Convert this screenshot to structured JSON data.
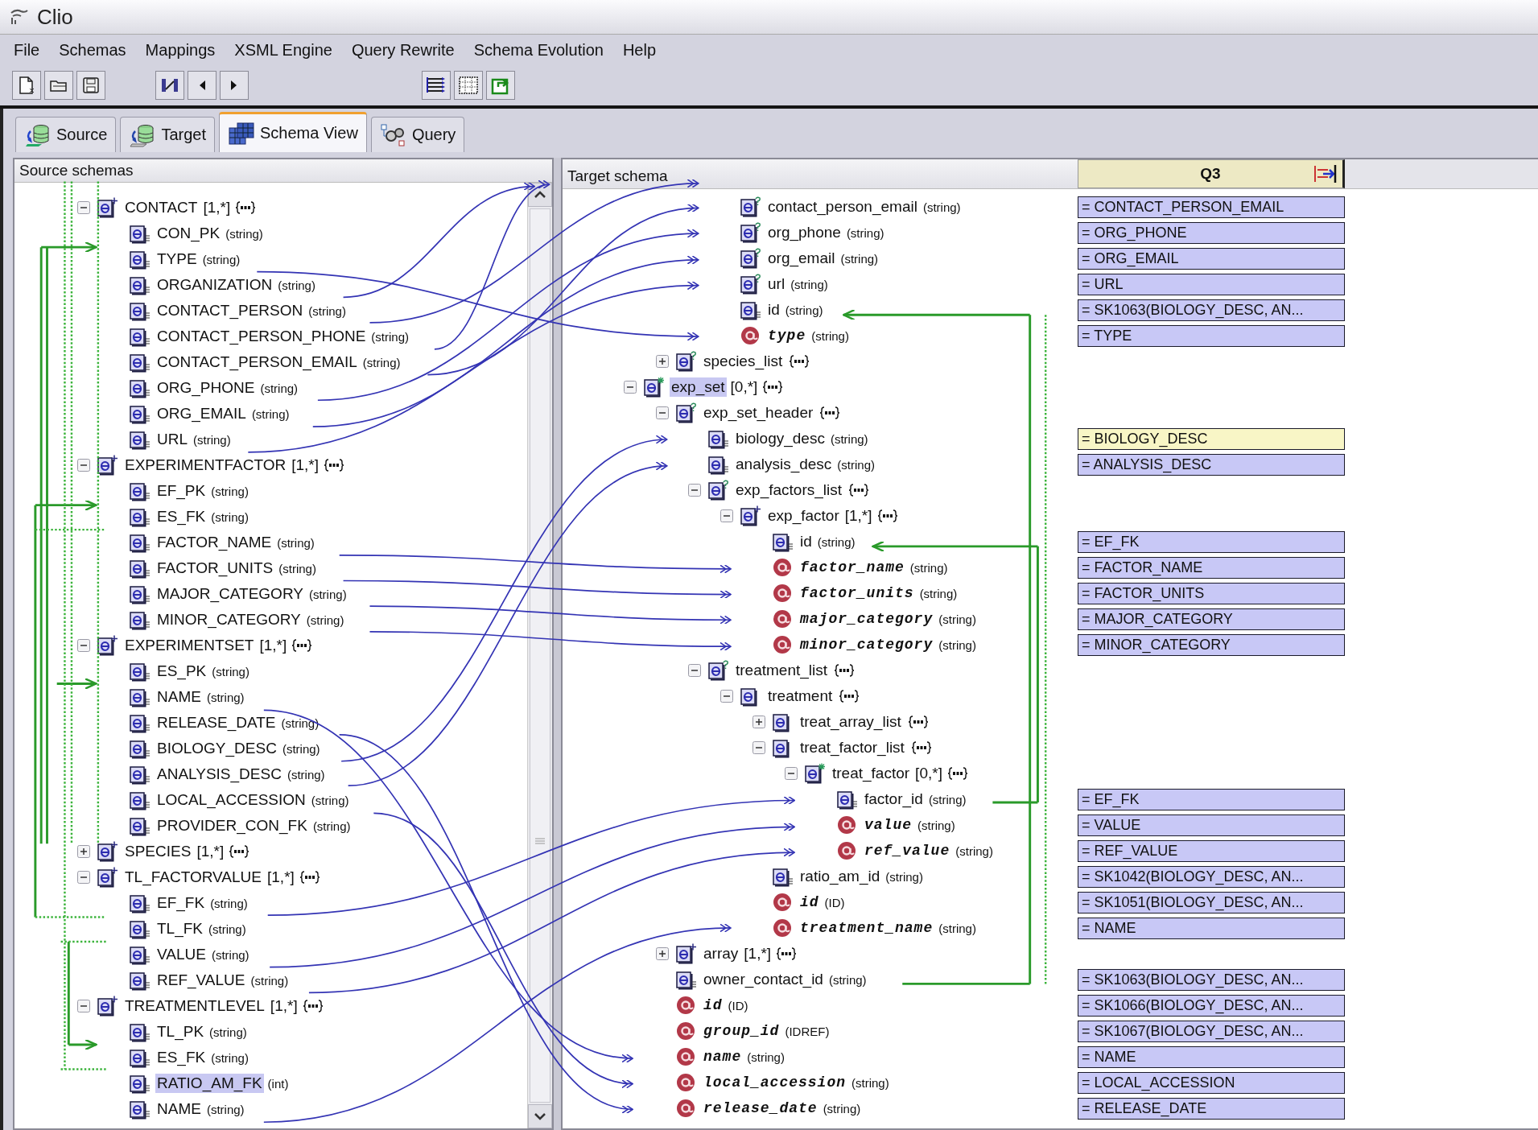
{
  "window": {
    "title": "Clio"
  },
  "menu": [
    "File",
    "Schemas",
    "Mappings",
    "XSML Engine",
    "Query Rewrite",
    "Schema Evolution",
    "Help"
  ],
  "tabs": [
    {
      "label": "Source",
      "kind": "source",
      "selected": false
    },
    {
      "label": "Target",
      "kind": "target",
      "selected": false
    },
    {
      "label": "Schema View",
      "kind": "view",
      "selected": true
    },
    {
      "label": "Query",
      "kind": "query",
      "selected": false
    }
  ],
  "source_panel": {
    "title": "Source schemas",
    "tree": [
      {
        "name": "CONTACT",
        "card": "[1,*]",
        "kind": "repeat",
        "expanded": true,
        "selected": false,
        "children": [
          {
            "name": "CON_PK",
            "type": "(string)",
            "kind": "leaf",
            "selected": false
          },
          {
            "name": "TYPE",
            "type": "(string)",
            "kind": "leaf",
            "selected": false
          },
          {
            "name": "ORGANIZATION",
            "type": "(string)",
            "kind": "leaf",
            "selected": false
          },
          {
            "name": "CONTACT_PERSON",
            "type": "(string)",
            "kind": "leaf",
            "selected": false
          },
          {
            "name": "CONTACT_PERSON_PHONE",
            "type": "(string)",
            "kind": "leaf",
            "selected": false
          },
          {
            "name": "CONTACT_PERSON_EMAIL",
            "type": "(string)",
            "kind": "leaf",
            "selected": false
          },
          {
            "name": "ORG_PHONE",
            "type": "(string)",
            "kind": "leaf",
            "selected": false
          },
          {
            "name": "ORG_EMAIL",
            "type": "(string)",
            "kind": "leaf",
            "selected": false
          },
          {
            "name": "URL",
            "type": "(string)",
            "kind": "leaf",
            "selected": false
          }
        ]
      },
      {
        "name": "EXPERIMENTFACTOR",
        "card": "[1,*]",
        "kind": "repeat",
        "expanded": true,
        "selected": false,
        "children": [
          {
            "name": "EF_PK",
            "type": "(string)",
            "kind": "leaf",
            "selected": false
          },
          {
            "name": "ES_FK",
            "type": "(string)",
            "kind": "leaf",
            "selected": false
          },
          {
            "name": "FACTOR_NAME",
            "type": "(string)",
            "kind": "leaf",
            "selected": false
          },
          {
            "name": "FACTOR_UNITS",
            "type": "(string)",
            "kind": "leaf",
            "selected": false
          },
          {
            "name": "MAJOR_CATEGORY",
            "type": "(string)",
            "kind": "leaf",
            "selected": false
          },
          {
            "name": "MINOR_CATEGORY",
            "type": "(string)",
            "kind": "leaf",
            "selected": false
          }
        ]
      },
      {
        "name": "EXPERIMENTSET",
        "card": "[1,*]",
        "kind": "repeat",
        "expanded": true,
        "selected": false,
        "children": [
          {
            "name": "ES_PK",
            "type": "(string)",
            "kind": "leaf",
            "selected": false
          },
          {
            "name": "NAME",
            "type": "(string)",
            "kind": "leaf",
            "selected": false
          },
          {
            "name": "RELEASE_DATE",
            "type": "(string)",
            "kind": "leaf",
            "selected": false
          },
          {
            "name": "BIOLOGY_DESC",
            "type": "(string)",
            "kind": "leaf",
            "selected": false
          },
          {
            "name": "ANALYSIS_DESC",
            "type": "(string)",
            "kind": "leaf",
            "selected": false
          },
          {
            "name": "LOCAL_ACCESSION",
            "type": "(string)",
            "kind": "leaf",
            "selected": false
          },
          {
            "name": "PROVIDER_CON_FK",
            "type": "(string)",
            "kind": "leaf",
            "selected": false
          }
        ]
      },
      {
        "name": "SPECIES",
        "card": "[1,*]",
        "kind": "repeat",
        "expanded": false,
        "selected": false
      },
      {
        "name": "TL_FACTORVALUE",
        "card": "[1,*]",
        "kind": "repeat",
        "expanded": true,
        "selected": false,
        "children": [
          {
            "name": "EF_FK",
            "type": "(string)",
            "kind": "leaf",
            "selected": false
          },
          {
            "name": "TL_FK",
            "type": "(string)",
            "kind": "leaf",
            "selected": false
          },
          {
            "name": "VALUE",
            "type": "(string)",
            "kind": "leaf",
            "selected": false
          },
          {
            "name": "REF_VALUE",
            "type": "(string)",
            "kind": "leaf",
            "selected": false
          }
        ]
      },
      {
        "name": "TREATMENTLEVEL",
        "card": "[1,*]",
        "kind": "repeat",
        "expanded": true,
        "selected": false,
        "children": [
          {
            "name": "TL_PK",
            "type": "(string)",
            "kind": "leaf",
            "selected": false
          },
          {
            "name": "ES_FK",
            "type": "(string)",
            "kind": "leaf",
            "selected": false
          },
          {
            "name": "RATIO_AM_FK",
            "type": "(int)",
            "kind": "leaf",
            "selected": true
          },
          {
            "name": "NAME",
            "type": "(string)",
            "kind": "leaf",
            "selected": false
          }
        ]
      }
    ]
  },
  "target_panel": {
    "title": "Target schema",
    "mapping_header": "Q3",
    "tree": [
      {
        "children": [
          {
            "children": [
              {
                "children": [
                  {
                    "name": "contact_person_email",
                    "type": "(string)",
                    "kind": "optional",
                    "selected": false,
                    "mapping": {
                      "text": "= CONTACT_PERSON_EMAIL",
                      "selected": false
                    }
                  },
                  {
                    "name": "org_phone",
                    "type": "(string)",
                    "kind": "optional",
                    "selected": false,
                    "mapping": {
                      "text": "= ORG_PHONE",
                      "selected": false
                    }
                  },
                  {
                    "name": "org_email",
                    "type": "(string)",
                    "kind": "optional",
                    "selected": false,
                    "mapping": {
                      "text": "= ORG_EMAIL",
                      "selected": false
                    }
                  },
                  {
                    "name": "url",
                    "type": "(string)",
                    "kind": "optional",
                    "selected": false,
                    "mapping": {
                      "text": "= URL",
                      "selected": false
                    }
                  },
                  {
                    "name": "id",
                    "type": "(string)",
                    "kind": "leaf",
                    "selected": false,
                    "mapping": {
                      "text": "= SK1063(BIOLOGY_DESC, AN...",
                      "selected": false
                    }
                  },
                  {
                    "name": "type",
                    "type": "(string)",
                    "kind": "attribute",
                    "selected": false,
                    "mapping": {
                      "text": "= TYPE",
                      "selected": false
                    }
                  }
                ]
              }
            ]
          },
          {
            "name": "species_list",
            "kind": "optional",
            "expanded": false,
            "selected": false
          }
        ]
      },
      {
        "name": "exp_set",
        "card": "[0,*]",
        "kind": "any",
        "expanded": true,
        "selected": true,
        "children": [
          {
            "name": "exp_set_header",
            "kind": "optional",
            "expanded": true,
            "selected": false,
            "children": [
              {
                "name": "biology_desc",
                "type": "(string)",
                "kind": "leaf",
                "selected": false,
                "mapping": {
                  "text": "= BIOLOGY_DESC",
                  "selected": true
                }
              },
              {
                "name": "analysis_desc",
                "type": "(string)",
                "kind": "leaf",
                "selected": false,
                "mapping": {
                  "text": "= ANALYSIS_DESC",
                  "selected": false
                }
              },
              {
                "name": "exp_factors_list",
                "kind": "optional",
                "expanded": true,
                "selected": false,
                "children": [
                  {
                    "name": "exp_factor",
                    "card": "[1,*]",
                    "kind": "repeat",
                    "expanded": true,
                    "selected": false,
                    "children": [
                      {
                        "name": "id",
                        "type": "(string)",
                        "kind": "leaf",
                        "selected": false,
                        "mapping": {
                          "text": "= EF_FK",
                          "selected": false
                        }
                      },
                      {
                        "name": "factor_name",
                        "type": "(string)",
                        "kind": "attribute",
                        "selected": false,
                        "mapping": {
                          "text": "= FACTOR_NAME",
                          "selected": false
                        }
                      },
                      {
                        "name": "factor_units",
                        "type": "(string)",
                        "kind": "attribute",
                        "selected": false,
                        "mapping": {
                          "text": "= FACTOR_UNITS",
                          "selected": false
                        }
                      },
                      {
                        "name": "major_category",
                        "type": "(string)",
                        "kind": "attribute",
                        "selected": false,
                        "mapping": {
                          "text": "= MAJOR_CATEGORY",
                          "selected": false
                        }
                      },
                      {
                        "name": "minor_category",
                        "type": "(string)",
                        "kind": "attribute",
                        "selected": false,
                        "mapping": {
                          "text": "= MINOR_CATEGORY",
                          "selected": false
                        }
                      }
                    ]
                  }
                ]
              },
              {
                "name": "treatment_list",
                "kind": "optional",
                "expanded": true,
                "selected": false,
                "children": [
                  {
                    "name": "treatment",
                    "kind": "plain",
                    "expanded": true,
                    "selected": false,
                    "children": [
                      {
                        "name": "treat_array_list",
                        "kind": "plain",
                        "expanded": false,
                        "selected": false
                      },
                      {
                        "name": "treat_factor_list",
                        "kind": "plain",
                        "expanded": true,
                        "selected": false,
                        "children": [
                          {
                            "name": "treat_factor",
                            "card": "[0,*]",
                            "kind": "any",
                            "expanded": true,
                            "selected": false,
                            "children": [
                              {
                                "name": "factor_id",
                                "type": "(string)",
                                "kind": "leaf",
                                "selected": false,
                                "mapping": {
                                  "text": "= EF_FK",
                                  "selected": false
                                }
                              },
                              {
                                "name": "value",
                                "type": "(string)",
                                "kind": "attribute",
                                "selected": false,
                                "mapping": {
                                  "text": "= VALUE",
                                  "selected": false
                                }
                              },
                              {
                                "name": "ref_value",
                                "type": "(string)",
                                "kind": "attribute",
                                "selected": false,
                                "mapping": {
                                  "text": "= REF_VALUE",
                                  "selected": false
                                }
                              }
                            ]
                          }
                        ]
                      },
                      {
                        "name": "ratio_am_id",
                        "type": "(string)",
                        "kind": "leaf",
                        "selected": false,
                        "mapping": {
                          "text": "= SK1042(BIOLOGY_DESC, AN...",
                          "selected": false
                        }
                      },
                      {
                        "name": "id",
                        "type": "(ID)",
                        "kind": "attribute",
                        "selected": false,
                        "mapping": {
                          "text": "= SK1051(BIOLOGY_DESC, AN...",
                          "selected": false
                        }
                      },
                      {
                        "name": "treatment_name",
                        "type": "(string)",
                        "kind": "attribute",
                        "selected": false,
                        "mapping": {
                          "text": "= NAME",
                          "selected": false
                        }
                      }
                    ]
                  }
                ]
              }
            ]
          },
          {
            "name": "array",
            "card": "[1,*]",
            "kind": "repeat",
            "expanded": false,
            "selected": false
          },
          {
            "name": "owner_contact_id",
            "type": "(string)",
            "kind": "leaf",
            "selected": false,
            "mapping": {
              "text": "= SK1063(BIOLOGY_DESC, AN...",
              "selected": false
            }
          },
          {
            "name": "id",
            "type": "(ID)",
            "kind": "attribute",
            "selected": false,
            "mapping": {
              "text": "= SK1066(BIOLOGY_DESC, AN...",
              "selected": false
            }
          },
          {
            "name": "group_id",
            "type": "(IDREF)",
            "kind": "attribute",
            "selected": false,
            "mapping": {
              "text": "= SK1067(BIOLOGY_DESC, AN...",
              "selected": false
            }
          },
          {
            "name": "name",
            "type": "(string)",
            "kind": "attribute",
            "selected": false,
            "mapping": {
              "text": "= NAME",
              "selected": false
            }
          },
          {
            "name": "local_accession",
            "type": "(string)",
            "kind": "attribute",
            "selected": false,
            "mapping": {
              "text": "= LOCAL_ACCESSION",
              "selected": false
            }
          },
          {
            "name": "release_date",
            "type": "(string)",
            "kind": "attribute",
            "selected": false,
            "mapping": {
              "text": "= RELEASE_DATE",
              "selected": false
            }
          }
        ]
      }
    ]
  }
}
